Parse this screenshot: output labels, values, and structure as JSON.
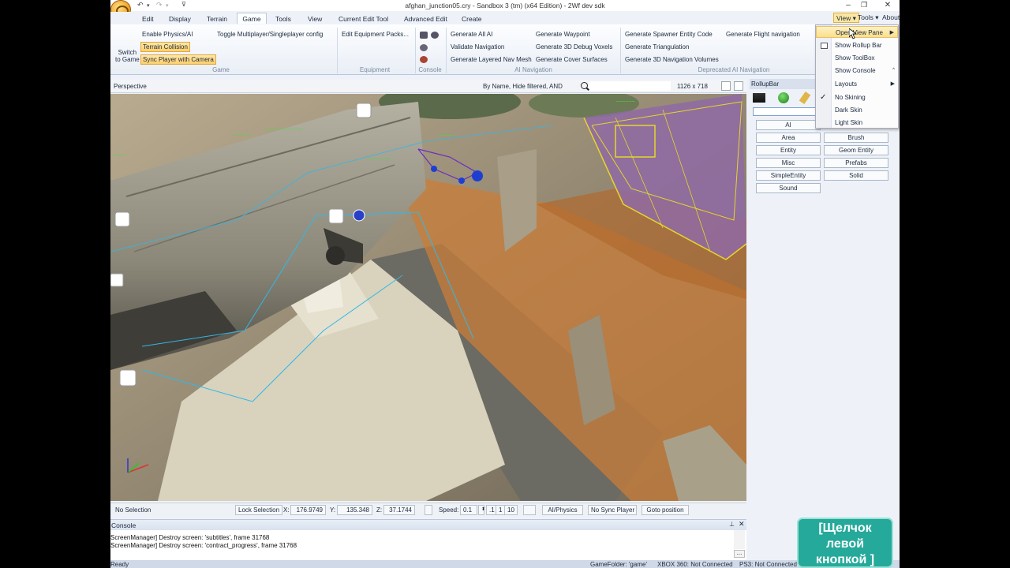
{
  "window": {
    "title": "afghan_junction05.cry - Sandbox 3 (tm) (x64 Edition) - 2Wf dev sdk"
  },
  "menu": {
    "tabs": [
      "Edit",
      "Display",
      "Terrain",
      "Game",
      "Tools",
      "View",
      "Current Edit Tool",
      "Advanced Edit",
      "Create"
    ],
    "active_tab": "Game",
    "right_tabs": [
      "View",
      "Tools",
      "About"
    ]
  },
  "ribbon": {
    "switch_to_game": [
      "Switch",
      "to Game"
    ],
    "game_items": [
      "Enable Physics/AI",
      "Terrain Collision",
      "Sync Player with Camera"
    ],
    "toggle_multiplayer": "Toggle Multiplayer/Singleplayer config",
    "game_group": "Game",
    "equipment_item": "Edit Equipment Packs...",
    "equipment_group": "Equipment",
    "console_group": "Console",
    "ai_col1": [
      "Generate All AI",
      "Validate Navigation",
      "Generate Layered Nav Mesh"
    ],
    "ai_col2": [
      "Generate Waypoint",
      "Generate 3D Debug Voxels",
      "Generate Cover Surfaces"
    ],
    "ai_group": "AI Navigation",
    "dep_col1": [
      "Generate Spawner Entity Code",
      "Generate Triangulation",
      "Generate 3D Navigation Volumes"
    ],
    "dep_col2": [
      "Generate Flight navigation"
    ],
    "dep_group": "Deprecated AI Navigation"
  },
  "viewport": {
    "name": "Perspective",
    "filter": "By Name, Hide filtered, AND",
    "resolution": "1126 x 718"
  },
  "status": {
    "selection": "No Selection",
    "lock_selection": "Lock Selection",
    "x_label": "X:",
    "x_value": "176.9749",
    "y_label": "Y:",
    "y_value": "135.348",
    "z_label": "Z:",
    "z_value": "37.1744",
    "speed_label": "Speed:",
    "speed_value": "0.1",
    "speed_presets": [
      ".1",
      "1",
      "10"
    ],
    "ai_physics": "AI/Physics",
    "no_sync_player": "No Sync Player",
    "goto_position": "Goto position"
  },
  "console": {
    "title": "Console",
    "lines": [
      "ScreenManager] Destroy screen: 'subtitles', frame 31768",
      "ScreenManager] Destroy screen: 'contract_progress', frame 31768"
    ],
    "more": "..."
  },
  "bottom_status": {
    "ready": "Ready",
    "game_folder": "GameFolder: 'game'",
    "xbox": "XBOX 360: Not Connected",
    "ps3": "PS3: Not Connected"
  },
  "rollup": {
    "title": "RollupBar",
    "buttons_left": [
      "AI",
      "Area",
      "Entity",
      "Misc",
      "SimpleEntity",
      "Sound"
    ],
    "buttons_right": [
      "Brush",
      "Geom Entity",
      "Prefabs",
      "Solid"
    ]
  },
  "view_menu": {
    "items": [
      "Open View Pane",
      "Show Rollup Bar",
      "Show ToolBox",
      "Show Console",
      "Layouts",
      "No Skining",
      "Dark Skin",
      "Light Skin"
    ],
    "checked": "No Skining"
  },
  "overlay_note": [
    "[Щелчок",
    "левой",
    "кнопкой ]"
  ]
}
